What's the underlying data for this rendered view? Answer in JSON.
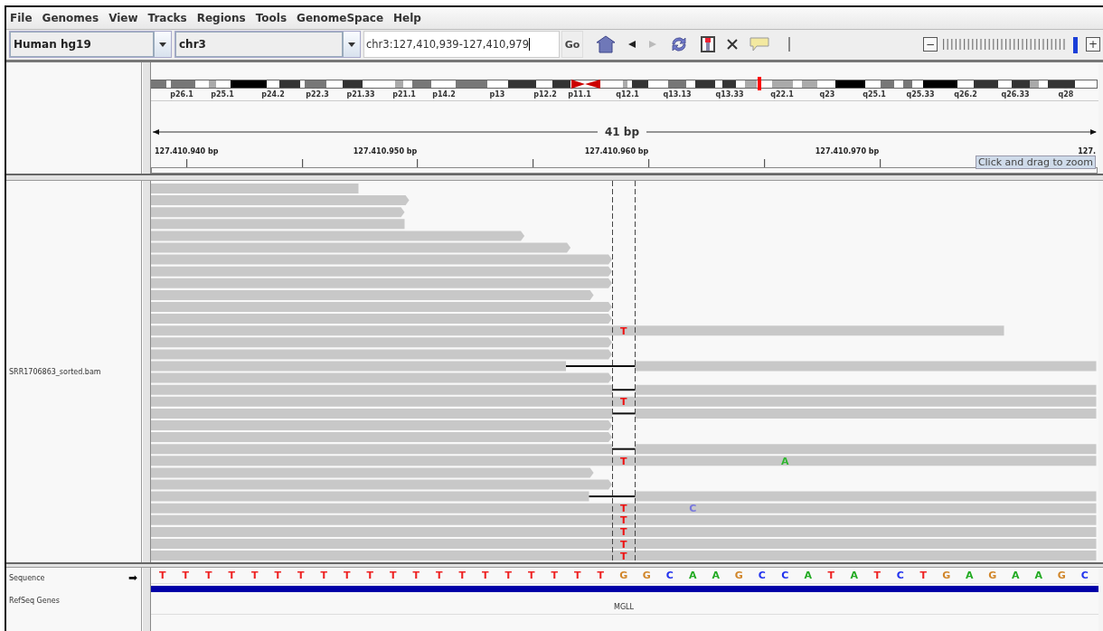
{
  "menu": [
    "File",
    "Genomes",
    "View",
    "Tracks",
    "Regions",
    "Tools",
    "GenomeSpace",
    "Help"
  ],
  "toolbar": {
    "genome": "Human hg19",
    "chromosome": "chr3",
    "locus": "chr3:127,410,939-127,410,979",
    "go": "Go",
    "buttons": [
      {
        "kind": "home",
        "disabled": false
      },
      {
        "kind": "back",
        "disabled": false
      },
      {
        "kind": "forward",
        "disabled": true
      },
      {
        "kind": "refresh",
        "disabled": false
      },
      {
        "kind": "roi",
        "disabled": false
      },
      {
        "kind": "close",
        "disabled": false
      },
      {
        "kind": "popup",
        "disabled": false
      }
    ],
    "zoom": {
      "minus": "−",
      "plus": "+",
      "level": 0.97
    }
  },
  "ideogram": {
    "bands": [
      "p26.1",
      "p25.1",
      "p24.2",
      "p22.3",
      "p21.33",
      "p21.1",
      "p14.2",
      "p13",
      "p12.2",
      "p11.1",
      "q12.1",
      "q13.13",
      "q13.33",
      "q22.1",
      "q23",
      "q25.1",
      "q25.33",
      "q26.2",
      "q26.33",
      "q28"
    ]
  },
  "ruler": {
    "span": "41 bp",
    "ticks": [
      "127.410.940 bp",
      "127.410.950 bp",
      "127.410.960 bp",
      "127.410.970 bp",
      "127."
    ],
    "tooltip": "Click and drag to zoom"
  },
  "alignment_track": {
    "name": "SRR1706863_sorted.bam",
    "mismatches": [
      {
        "base": "T",
        "color": "#ee1111"
      },
      {
        "base": "T",
        "color": "#ee1111"
      },
      {
        "base": "T",
        "color": "#ee1111"
      },
      {
        "base": "A",
        "color": "#2fb52f"
      },
      {
        "base": "T",
        "color": "#ee1111"
      },
      {
        "base": "C",
        "color": "#7777dd"
      },
      {
        "base": "T",
        "color": "#ee1111"
      },
      {
        "base": "T",
        "color": "#ee1111"
      },
      {
        "base": "T",
        "color": "#ee1111"
      },
      {
        "base": "T",
        "color": "#ee1111"
      }
    ]
  },
  "sequence_track": {
    "name": "Sequence",
    "arrow": "➡",
    "bases": [
      {
        "base": "T",
        "color": "#ee2222"
      },
      {
        "base": "T",
        "color": "#ee2222"
      },
      {
        "base": "T",
        "color": "#ee2222"
      },
      {
        "base": "T",
        "color": "#ee2222"
      },
      {
        "base": "T",
        "color": "#ee2222"
      },
      {
        "base": "T",
        "color": "#ee2222"
      },
      {
        "base": "T",
        "color": "#ee2222"
      },
      {
        "base": "T",
        "color": "#ee2222"
      },
      {
        "base": "T",
        "color": "#ee2222"
      },
      {
        "base": "T",
        "color": "#ee2222"
      },
      {
        "base": "T",
        "color": "#ee2222"
      },
      {
        "base": "T",
        "color": "#ee2222"
      },
      {
        "base": "T",
        "color": "#ee2222"
      },
      {
        "base": "T",
        "color": "#ee2222"
      },
      {
        "base": "T",
        "color": "#ee2222"
      },
      {
        "base": "T",
        "color": "#ee2222"
      },
      {
        "base": "T",
        "color": "#ee2222"
      },
      {
        "base": "T",
        "color": "#ee2222"
      },
      {
        "base": "T",
        "color": "#ee2222"
      },
      {
        "base": "T",
        "color": "#ee2222"
      },
      {
        "base": "G",
        "color": "#d1862a"
      },
      {
        "base": "G",
        "color": "#d1862a"
      },
      {
        "base": "C",
        "color": "#2233ee"
      },
      {
        "base": "A",
        "color": "#22aa22"
      },
      {
        "base": "A",
        "color": "#22aa22"
      },
      {
        "base": "G",
        "color": "#d1862a"
      },
      {
        "base": "C",
        "color": "#2233ee"
      },
      {
        "base": "C",
        "color": "#2233ee"
      },
      {
        "base": "A",
        "color": "#22aa22"
      },
      {
        "base": "T",
        "color": "#ee2222"
      },
      {
        "base": "A",
        "color": "#22aa22"
      },
      {
        "base": "T",
        "color": "#ee2222"
      },
      {
        "base": "C",
        "color": "#2233ee"
      },
      {
        "base": "T",
        "color": "#ee2222"
      },
      {
        "base": "G",
        "color": "#d1862a"
      },
      {
        "base": "A",
        "color": "#22aa22"
      },
      {
        "base": "G",
        "color": "#d1862a"
      },
      {
        "base": "A",
        "color": "#22aa22"
      },
      {
        "base": "A",
        "color": "#22aa22"
      },
      {
        "base": "G",
        "color": "#d1862a"
      },
      {
        "base": "C",
        "color": "#2233ee"
      }
    ]
  },
  "gene_track": {
    "name": "RefSeq Genes",
    "gene": "MGLL"
  }
}
